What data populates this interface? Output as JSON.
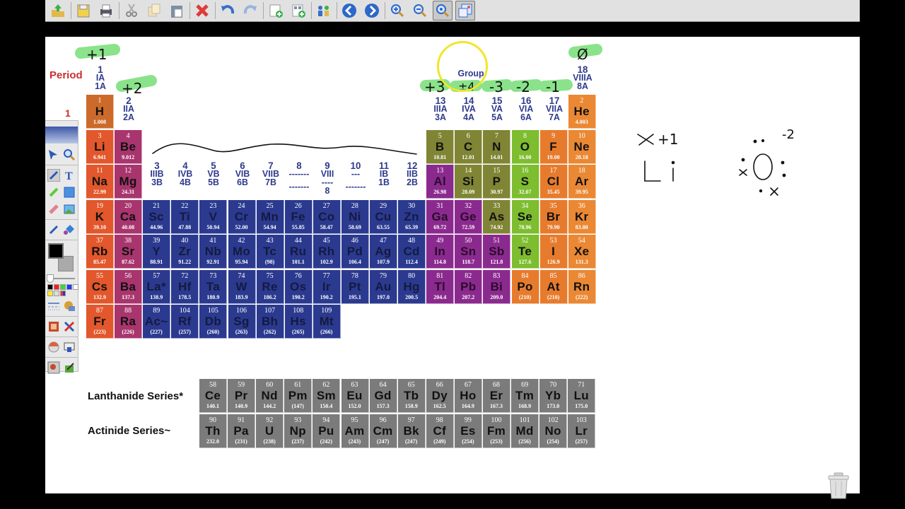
{
  "toolbar": {
    "buttons": [
      {
        "name": "open-file",
        "icon": "folder-up-icon"
      },
      {
        "name": "save",
        "icon": "floppy-disk-icon"
      },
      {
        "name": "print",
        "icon": "printer-icon"
      },
      {
        "name": "cut",
        "icon": "scissors-icon"
      },
      {
        "name": "copy",
        "icon": "copy-icon"
      },
      {
        "name": "paste",
        "icon": "clipboard-icon"
      },
      {
        "name": "delete",
        "icon": "red-x-icon"
      },
      {
        "name": "undo",
        "icon": "undo-arrow-icon"
      },
      {
        "name": "redo",
        "icon": "redo-arrow-icon"
      },
      {
        "name": "add-page",
        "icon": "blank-page-plus-icon"
      },
      {
        "name": "add-page-template",
        "icon": "grid-page-plus-icon"
      },
      {
        "name": "participants",
        "icon": "people-icon"
      },
      {
        "name": "previous-page",
        "icon": "left-arrow-circle-icon"
      },
      {
        "name": "next-page",
        "icon": "right-arrow-circle-icon"
      },
      {
        "name": "zoom-in",
        "icon": "magnifier-plus-icon"
      },
      {
        "name": "zoom-out",
        "icon": "magnifier-minus-icon"
      },
      {
        "name": "zoom-fit",
        "icon": "magnifier-fit-icon"
      },
      {
        "name": "display-mode",
        "icon": "windows-icon"
      }
    ]
  },
  "table": {
    "period_label": "Period",
    "period_1": "1",
    "groups": [
      {
        "num": "1",
        "roman": "IA",
        "us": "1A"
      },
      {
        "num": "2",
        "roman": "IIA",
        "us": "2A"
      },
      {
        "num": "3",
        "roman": "IIIB",
        "us": "3B"
      },
      {
        "num": "4",
        "roman": "IVB",
        "us": "4B"
      },
      {
        "num": "5",
        "roman": "VB",
        "us": "5B"
      },
      {
        "num": "6",
        "roman": "VIB",
        "us": "6B"
      },
      {
        "num": "7",
        "roman": "VIIB",
        "us": "7B"
      },
      {
        "num": "8",
        "roman": "-------",
        "us": "-------"
      },
      {
        "num": "9",
        "roman": "VIII",
        "us": "----",
        "extra": "8"
      },
      {
        "num": "10",
        "roman": "---",
        "us": "-------"
      },
      {
        "num": "11",
        "roman": "IB",
        "us": "1B"
      },
      {
        "num": "12",
        "roman": "IIB",
        "us": "2B"
      },
      {
        "num": "13",
        "roman": "IIIA",
        "us": "3A"
      },
      {
        "num": "14",
        "roman": "IVA",
        "us": "4A"
      },
      {
        "num": "15",
        "roman": "VA",
        "us": "5A"
      },
      {
        "num": "16",
        "roman": "VIA",
        "us": "6A"
      },
      {
        "num": "17",
        "roman": "VIIA",
        "us": "7A"
      },
      {
        "num": "18",
        "roman": "VIIIA",
        "us": "8A"
      }
    ],
    "group_heading": "Group",
    "lanthanide_label": "Lanthanide Series*",
    "actinide_label": "Actinide Series~",
    "elements": [
      {
        "z": "1",
        "s": "H",
        "m": "1.008",
        "c": "c-h",
        "r": 0,
        "g": 0
      },
      {
        "z": "2",
        "s": "He",
        "m": "4.003",
        "c": "c-ng",
        "r": 0,
        "g": 17
      },
      {
        "z": "3",
        "s": "Li",
        "m": "6.941",
        "c": "c-alk",
        "r": 1,
        "g": 0
      },
      {
        "z": "4",
        "s": "Be",
        "m": "9.012",
        "c": "c-ae",
        "r": 1,
        "g": 1
      },
      {
        "z": "5",
        "s": "B",
        "m": "10.81",
        "c": "c-ml",
        "r": 1,
        "g": 12
      },
      {
        "z": "6",
        "s": "C",
        "m": "12.01",
        "c": "c-ml",
        "r": 1,
        "g": 13
      },
      {
        "z": "7",
        "s": "N",
        "m": "14.01",
        "c": "c-ml",
        "r": 1,
        "g": 14
      },
      {
        "z": "8",
        "s": "O",
        "m": "16.00",
        "c": "c-nm",
        "r": 1,
        "g": 15
      },
      {
        "z": "9",
        "s": "F",
        "m": "19.00",
        "c": "c-hal",
        "r": 1,
        "g": 16
      },
      {
        "z": "10",
        "s": "Ne",
        "m": "20.18",
        "c": "c-ng",
        "r": 1,
        "g": 17
      },
      {
        "z": "11",
        "s": "Na",
        "m": "22.99",
        "c": "c-alk",
        "r": 2,
        "g": 0
      },
      {
        "z": "12",
        "s": "Mg",
        "m": "24.31",
        "c": "c-ae",
        "r": 2,
        "g": 1
      },
      {
        "z": "13",
        "s": "Al",
        "m": "26.98",
        "c": "c-pm",
        "r": 2,
        "g": 12
      },
      {
        "z": "14",
        "s": "Si",
        "m": "28.09",
        "c": "c-ml",
        "r": 2,
        "g": 13
      },
      {
        "z": "15",
        "s": "P",
        "m": "30.97",
        "c": "c-ml",
        "r": 2,
        "g": 14
      },
      {
        "z": "16",
        "s": "S",
        "m": "32.07",
        "c": "c-nm",
        "r": 2,
        "g": 15
      },
      {
        "z": "17",
        "s": "Cl",
        "m": "35.45",
        "c": "c-hal",
        "r": 2,
        "g": 16
      },
      {
        "z": "18",
        "s": "Ar",
        "m": "39.95",
        "c": "c-ng",
        "r": 2,
        "g": 17
      },
      {
        "z": "19",
        "s": "K",
        "m": "39.10",
        "c": "c-alk",
        "r": 3,
        "g": 0
      },
      {
        "z": "20",
        "s": "Ca",
        "m": "40.08",
        "c": "c-ae",
        "r": 3,
        "g": 1
      },
      {
        "z": "21",
        "s": "Sc",
        "m": "44.96",
        "c": "c-tm",
        "r": 3,
        "g": 2
      },
      {
        "z": "22",
        "s": "Ti",
        "m": "47.88",
        "c": "c-tm",
        "r": 3,
        "g": 3
      },
      {
        "z": "23",
        "s": "V",
        "m": "50.94",
        "c": "c-tm",
        "r": 3,
        "g": 4
      },
      {
        "z": "24",
        "s": "Cr",
        "m": "52.00",
        "c": "c-tm",
        "r": 3,
        "g": 5
      },
      {
        "z": "25",
        "s": "Mn",
        "m": "54.94",
        "c": "c-tm",
        "r": 3,
        "g": 6
      },
      {
        "z": "26",
        "s": "Fe",
        "m": "55.85",
        "c": "c-tm",
        "r": 3,
        "g": 7
      },
      {
        "z": "27",
        "s": "Co",
        "m": "58.47",
        "c": "c-tm",
        "r": 3,
        "g": 8
      },
      {
        "z": "28",
        "s": "Ni",
        "m": "58.69",
        "c": "c-tm",
        "r": 3,
        "g": 9
      },
      {
        "z": "29",
        "s": "Cu",
        "m": "63.55",
        "c": "c-tm",
        "r": 3,
        "g": 10
      },
      {
        "z": "30",
        "s": "Zn",
        "m": "65.39",
        "c": "c-tm",
        "r": 3,
        "g": 11
      },
      {
        "z": "31",
        "s": "Ga",
        "m": "69.72",
        "c": "c-pm",
        "r": 3,
        "g": 12
      },
      {
        "z": "32",
        "s": "Ge",
        "m": "72.59",
        "c": "c-pm",
        "r": 3,
        "g": 13
      },
      {
        "z": "33",
        "s": "As",
        "m": "74.92",
        "c": "c-ml",
        "r": 3,
        "g": 14
      },
      {
        "z": "34",
        "s": "Se",
        "m": "78.96",
        "c": "c-nm",
        "r": 3,
        "g": 15
      },
      {
        "z": "35",
        "s": "Br",
        "m": "79.90",
        "c": "c-hal",
        "r": 3,
        "g": 16
      },
      {
        "z": "36",
        "s": "Kr",
        "m": "83.80",
        "c": "c-ng",
        "r": 3,
        "g": 17
      },
      {
        "z": "37",
        "s": "Rb",
        "m": "85.47",
        "c": "c-alk",
        "r": 4,
        "g": 0
      },
      {
        "z": "38",
        "s": "Sr",
        "m": "87.62",
        "c": "c-ae",
        "r": 4,
        "g": 1
      },
      {
        "z": "39",
        "s": "Y",
        "m": "88.91",
        "c": "c-tm",
        "r": 4,
        "g": 2
      },
      {
        "z": "40",
        "s": "Zr",
        "m": "91.22",
        "c": "c-tm",
        "r": 4,
        "g": 3
      },
      {
        "z": "41",
        "s": "Nb",
        "m": "92.91",
        "c": "c-tm",
        "r": 4,
        "g": 4
      },
      {
        "z": "42",
        "s": "Mo",
        "m": "95.94",
        "c": "c-tm",
        "r": 4,
        "g": 5
      },
      {
        "z": "43",
        "s": "Tc",
        "m": "(98)",
        "c": "c-tm",
        "r": 4,
        "g": 6
      },
      {
        "z": "44",
        "s": "Ru",
        "m": "101.1",
        "c": "c-tm",
        "r": 4,
        "g": 7
      },
      {
        "z": "45",
        "s": "Rh",
        "m": "102.9",
        "c": "c-tm",
        "r": 4,
        "g": 8
      },
      {
        "z": "46",
        "s": "Pd",
        "m": "106.4",
        "c": "c-tm",
        "r": 4,
        "g": 9
      },
      {
        "z": "47",
        "s": "Ag",
        "m": "107.9",
        "c": "c-tm",
        "r": 4,
        "g": 10
      },
      {
        "z": "48",
        "s": "Cd",
        "m": "112.4",
        "c": "c-tm",
        "r": 4,
        "g": 11
      },
      {
        "z": "49",
        "s": "In",
        "m": "114.8",
        "c": "c-pm",
        "r": 4,
        "g": 12
      },
      {
        "z": "50",
        "s": "Sn",
        "m": "118.7",
        "c": "c-pm",
        "r": 4,
        "g": 13
      },
      {
        "z": "51",
        "s": "Sb",
        "m": "121.8",
        "c": "c-pm",
        "r": 4,
        "g": 14
      },
      {
        "z": "52",
        "s": "Te",
        "m": "127.6",
        "c": "c-nm",
        "r": 4,
        "g": 15
      },
      {
        "z": "53",
        "s": "I",
        "m": "126.9",
        "c": "c-hal",
        "r": 4,
        "g": 16
      },
      {
        "z": "54",
        "s": "Xe",
        "m": "131.3",
        "c": "c-ng",
        "r": 4,
        "g": 17
      },
      {
        "z": "55",
        "s": "Cs",
        "m": "132.9",
        "c": "c-alk",
        "r": 5,
        "g": 0
      },
      {
        "z": "56",
        "s": "Ba",
        "m": "137.3",
        "c": "c-ae",
        "r": 5,
        "g": 1
      },
      {
        "z": "57",
        "s": "La*",
        "m": "138.9",
        "c": "c-tm",
        "r": 5,
        "g": 2
      },
      {
        "z": "72",
        "s": "Hf",
        "m": "178.5",
        "c": "c-tm",
        "r": 5,
        "g": 3
      },
      {
        "z": "73",
        "s": "Ta",
        "m": "180.9",
        "c": "c-tm",
        "r": 5,
        "g": 4
      },
      {
        "z": "74",
        "s": "W",
        "m": "183.9",
        "c": "c-tm",
        "r": 5,
        "g": 5
      },
      {
        "z": "75",
        "s": "Re",
        "m": "186.2",
        "c": "c-tm",
        "r": 5,
        "g": 6
      },
      {
        "z": "76",
        "s": "Os",
        "m": "190.2",
        "c": "c-tm",
        "r": 5,
        "g": 7
      },
      {
        "z": "77",
        "s": "Ir",
        "m": "190.2",
        "c": "c-tm",
        "r": 5,
        "g": 8
      },
      {
        "z": "78",
        "s": "Pt",
        "m": "195.1",
        "c": "c-tm",
        "r": 5,
        "g": 9
      },
      {
        "z": "79",
        "s": "Au",
        "m": "197.0",
        "c": "c-tm",
        "r": 5,
        "g": 10
      },
      {
        "z": "80",
        "s": "Hg",
        "m": "200.5",
        "c": "c-tm",
        "r": 5,
        "g": 11
      },
      {
        "z": "81",
        "s": "Tl",
        "m": "204.4",
        "c": "c-pm",
        "r": 5,
        "g": 12
      },
      {
        "z": "82",
        "s": "Pb",
        "m": "207.2",
        "c": "c-pm",
        "r": 5,
        "g": 13
      },
      {
        "z": "83",
        "s": "Bi",
        "m": "209.0",
        "c": "c-pm",
        "r": 5,
        "g": 14
      },
      {
        "z": "84",
        "s": "Po",
        "m": "(210)",
        "c": "c-hal",
        "r": 5,
        "g": 15
      },
      {
        "z": "85",
        "s": "At",
        "m": "(210)",
        "c": "c-hal",
        "r": 5,
        "g": 16
      },
      {
        "z": "86",
        "s": "Rn",
        "m": "(222)",
        "c": "c-ng",
        "r": 5,
        "g": 17
      },
      {
        "z": "87",
        "s": "Fr",
        "m": "(223)",
        "c": "c-alk",
        "r": 6,
        "g": 0
      },
      {
        "z": "88",
        "s": "Ra",
        "m": "(226)",
        "c": "c-ae",
        "r": 6,
        "g": 1
      },
      {
        "z": "89",
        "s": "Ac~",
        "m": "(227)",
        "c": "c-tm",
        "r": 6,
        "g": 2
      },
      {
        "z": "104",
        "s": "Rf",
        "m": "(257)",
        "c": "c-tm",
        "r": 6,
        "g": 3
      },
      {
        "z": "105",
        "s": "Db",
        "m": "(260)",
        "c": "c-tm",
        "r": 6,
        "g": 4
      },
      {
        "z": "106",
        "s": "Sg",
        "m": "(263)",
        "c": "c-tm",
        "r": 6,
        "g": 5
      },
      {
        "z": "107",
        "s": "Bh",
        "m": "(262)",
        "c": "c-tm",
        "r": 6,
        "g": 6
      },
      {
        "z": "108",
        "s": "Hs",
        "m": "(265)",
        "c": "c-tm",
        "r": 6,
        "g": 7
      },
      {
        "z": "109",
        "s": "Mt",
        "m": "(266)",
        "c": "c-tm",
        "r": 6,
        "g": 8
      }
    ],
    "lanthanides": [
      {
        "z": "58",
        "s": "Ce",
        "m": "140.1"
      },
      {
        "z": "59",
        "s": "Pr",
        "m": "140.9"
      },
      {
        "z": "60",
        "s": "Nd",
        "m": "144.2"
      },
      {
        "z": "61",
        "s": "Pm",
        "m": "(147)"
      },
      {
        "z": "62",
        "s": "Sm",
        "m": "150.4"
      },
      {
        "z": "63",
        "s": "Eu",
        "m": "152.0"
      },
      {
        "z": "64",
        "s": "Gd",
        "m": "157.3"
      },
      {
        "z": "65",
        "s": "Tb",
        "m": "158.9"
      },
      {
        "z": "66",
        "s": "Dy",
        "m": "162.5"
      },
      {
        "z": "67",
        "s": "Ho",
        "m": "164.9"
      },
      {
        "z": "68",
        "s": "Er",
        "m": "167.3"
      },
      {
        "z": "69",
        "s": "Tm",
        "m": "168.9"
      },
      {
        "z": "70",
        "s": "Yb",
        "m": "173.0"
      },
      {
        "z": "71",
        "s": "Lu",
        "m": "175.0"
      }
    ],
    "actinides": [
      {
        "z": "90",
        "s": "Th",
        "m": "232.0"
      },
      {
        "z": "91",
        "s": "Pa",
        "m": "(231)"
      },
      {
        "z": "92",
        "s": "U",
        "m": "(238)"
      },
      {
        "z": "93",
        "s": "Np",
        "m": "(237)"
      },
      {
        "z": "94",
        "s": "Pu",
        "m": "(242)"
      },
      {
        "z": "95",
        "s": "Am",
        "m": "(243)"
      },
      {
        "z": "96",
        "s": "Cm",
        "m": "(247)"
      },
      {
        "z": "97",
        "s": "Bk",
        "m": "(247)"
      },
      {
        "z": "98",
        "s": "Cf",
        "m": "(249)"
      },
      {
        "z": "99",
        "s": "Es",
        "m": "(254)"
      },
      {
        "z": "100",
        "s": "Fm",
        "m": "(253)"
      },
      {
        "z": "101",
        "s": "Md",
        "m": "(256)"
      },
      {
        "z": "102",
        "s": "No",
        "m": "(254)"
      },
      {
        "z": "103",
        "s": "Lr",
        "m": "(257)"
      }
    ]
  },
  "annotations": {
    "group1_charge": "+1",
    "group2_charge": "+2",
    "group13_charge": "+3",
    "group14_charge": "±4",
    "group15_charge": "-3",
    "group16_charge": "-2",
    "group17_charge": "-1",
    "group18_charge": "Ø",
    "li_charge": "+1",
    "li_symbol": "Li",
    "o_charge": "-2",
    "o_symbol": "O",
    "highlight_color": "#7ee07e"
  },
  "palette": {
    "colors": [
      "#000000",
      "#ff1a1a",
      "#33dd33",
      "#1a3aff",
      "#ffffff",
      "#ffee22",
      "#dddddd",
      "#multi"
    ]
  }
}
